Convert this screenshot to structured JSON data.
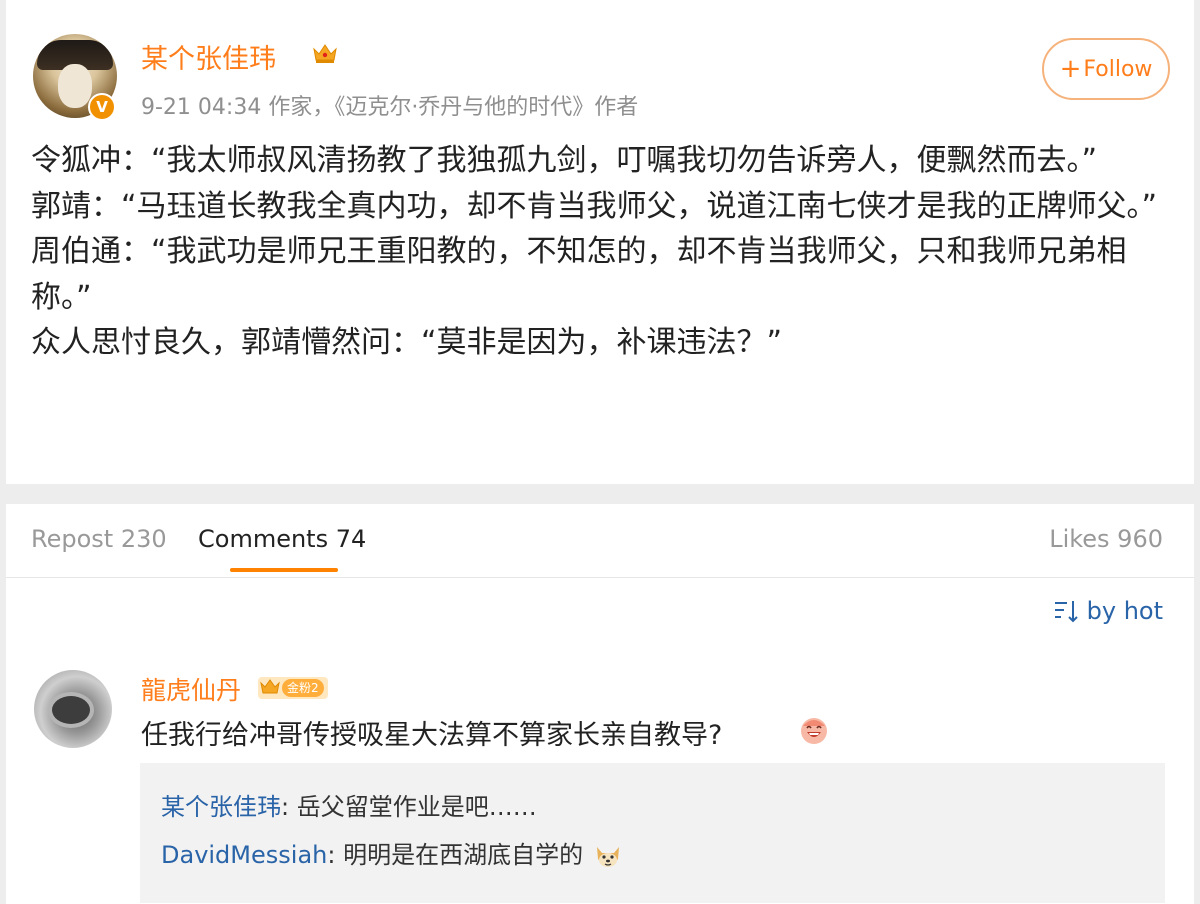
{
  "post": {
    "author": "某个张佳玮",
    "verified_badge": "V",
    "meta": "9-21 04:34  作家，《迈克尔·乔丹与他的时代》作者",
    "follow_plus": "+",
    "follow_label": "Follow",
    "paragraphs": [
      "令狐冲：“我太师叔风清扬教了我独孤九剑，叮嘱我切勿告诉旁人，便飘然而去。”",
      "郭靖：“马珏道长教我全真内功，却不肯当我师父，说道江南七侠才是我的正牌师父。”",
      "周伯通：“我武功是师兄王重阳教的，不知怎的，却不肯当我师父，只和我师兄弟相称。”",
      "众人思忖良久，郭靖懵然问：“莫非是因为，补课违法？”"
    ]
  },
  "tabs": {
    "repost": "Repost 230",
    "comments": "Comments 74",
    "likes": "Likes 960"
  },
  "sort_label": "by hot",
  "comment": {
    "author": "龍虎仙丹",
    "fan_badge": "金粉2",
    "text": "任我行给冲哥传授吸星大法算不算家长亲自教导?",
    "replies": [
      {
        "name": "某个张佳玮",
        "sep": ": ",
        "text": "岳父留堂作业是吧……"
      },
      {
        "name": "DavidMessiah",
        "sep": ": ",
        "text": "明明是在西湖底自学的"
      }
    ]
  },
  "colors": {
    "accent": "#ff7d1a",
    "link": "#2a64a8",
    "tab_underline": "#ff8200"
  }
}
